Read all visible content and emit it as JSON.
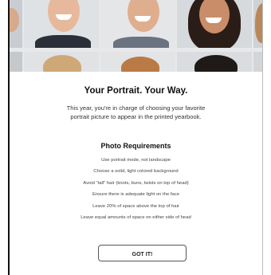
{
  "modal": {
    "title": "Your Portrait. Your Way.",
    "intro": "This year, you're in charge of choosing your favorite portrait picture to appear in the printed yearbook.",
    "requirements_title": "Photo Requirements",
    "requirements": [
      "Use portrait mode, not landscape",
      "Choose a solid, light colored background",
      "Avoid \"tall\" hair (knots, buns, twists on top of head)",
      "Ensure there is adequate light on the face",
      "Leave 20% of space above the top of hair",
      "Leave equal amounts of space on either side of head"
    ],
    "button_label": "GOT IT!"
  },
  "colors": {
    "background": "#ffffff",
    "text": "#111111",
    "border": "#555555"
  }
}
